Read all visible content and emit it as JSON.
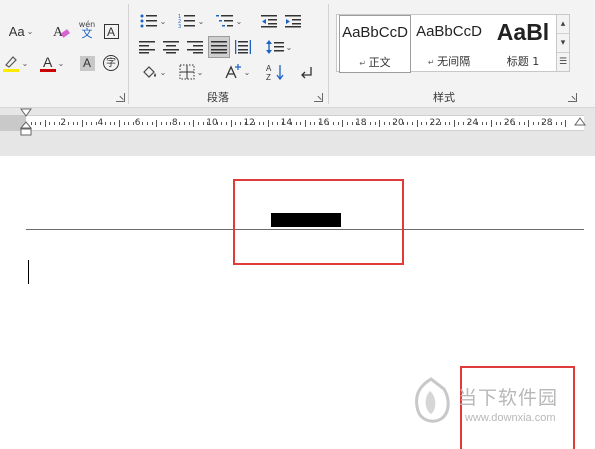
{
  "ribbon": {
    "font_group": {
      "font_size_button": "Aa",
      "phonetic_guide_top": "wén",
      "phonetic_guide_bottom": "文",
      "char_border": "A",
      "font_color_letter": "A",
      "char_shading": "A",
      "enclose_char": "字"
    },
    "paragraph_group": {
      "label": "段落",
      "sort_label": "A↓Z"
    },
    "styles_group": {
      "label": "样式",
      "styles": [
        {
          "sample": "AaBbCcD",
          "name": "正文"
        },
        {
          "sample": "AaBbCcD",
          "name": "无间隔"
        },
        {
          "sample": "AaBl",
          "name": "标题 1"
        }
      ]
    }
  },
  "ruler": {
    "numbers": [
      "2",
      "4",
      "6",
      "8",
      "10",
      "12",
      "14",
      "16",
      "18",
      "20",
      "22",
      "24",
      "26",
      "28",
      "30"
    ]
  },
  "watermark": {
    "title": "当下软件园",
    "url": "www.downxia.com"
  },
  "colors": {
    "highlight_box": "#e03b3b",
    "pen_yellow": "#ffeb00",
    "font_red": "#cc0000"
  }
}
